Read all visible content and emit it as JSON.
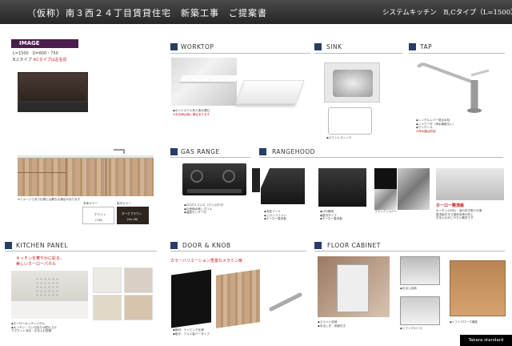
{
  "header": {
    "title": "（仮称）南３西２４丁目賃貸住宅　新築工事　ご提案書",
    "right_title": "システムキッチン　B,Cタイプ（L=1500）"
  },
  "image_section": {
    "badge": "IMAGE",
    "size_line": "L=1500　D=600・750",
    "type_line": "B,Cタイプ",
    "type_note": "※Cタイプは左右反",
    "note": "※イメージであり仕様とは異なる場合があります",
    "color_labels": [
      "本体カラー",
      "取手カラー"
    ],
    "swatches": [
      {
        "name": "ホワイト",
        "code": "(7/N)"
      },
      {
        "name": "ダークブラウン",
        "code": "(Xu-30)"
      }
    ]
  },
  "sections": {
    "worktop": "WORKTOP",
    "sink": "SINK",
    "tap": "TAP",
    "gas_range": "GAS RANGE",
    "rangehood": "RANGEHOOD",
    "kitchen_panel": "KITCHEN PANEL",
    "door_knob": "DOOR & KNOB",
    "floor_cabinet": "FLOOR CABINET"
  },
  "captions": {
    "worktop": [
      "◆ポリエステル系人造大理石",
      "※木目柄は無い場合あります"
    ],
    "sink": [
      "◆ステンレスシンク"
    ],
    "tap": [
      "◆シングルレバー混合水栓",
      "◆シャワー付（浄水機能なし）",
      "◆ワンホール",
      "※浄水器は別途"
    ],
    "gas_range": [
      "◆2口ガスコンロ（グリル付き）",
      "◆片面焼水無しグリル",
      "◆温度センサー付"
    ],
    "rangehood": [
      "◆浅型フード",
      "◆シロッコファン",
      "◆ホーロー整流板"
    ],
    "rangehood2": [
      "◆LED照明",
      "◆整流タイプ",
      "◆ホーロー整流板"
    ],
    "porcelain_title": "ホーロー整流板",
    "porcelain": [
      "キッチンの汚れ・油の拭き取りが楽",
      "整流板付きで換気効率が向上",
      "お手入れがしやすい素材です"
    ],
    "kitchen_panel": [
      "◆ホーローキッチンパネル",
      "◆キッチン・コンロ回りの壁仕上げ",
      "マグネット対応・お手入れ簡単"
    ],
    "door_knob": [
      "◆扉材：ラッピング仕様",
      "◆取手：アルミ製バータイプ"
    ],
    "floor_cabinet": [
      "◆スライド収納",
      "◆引出し式・底板付き"
    ],
    "cabinet2": [
      "◆引出し収納",
      "◆ソフトクローズ"
    ],
    "cabinet3": [
      "◆ソフトクローズ機能"
    ]
  },
  "red_notes": {
    "kitchen_panel": [
      "キッチンを華やかに彩る、",
      "美しいホーローパネル"
    ],
    "door_knob": "カラーバリエーション豊富なメラミン扉",
    "range_colors": "ブラックシルバー"
  },
  "footer": {
    "brand": "Takara standard"
  },
  "colors": {
    "header": "#2f2f2f",
    "section_square": "#2a3e63",
    "badge": "#4a1f4c",
    "accent_red": "#c41c1c"
  }
}
